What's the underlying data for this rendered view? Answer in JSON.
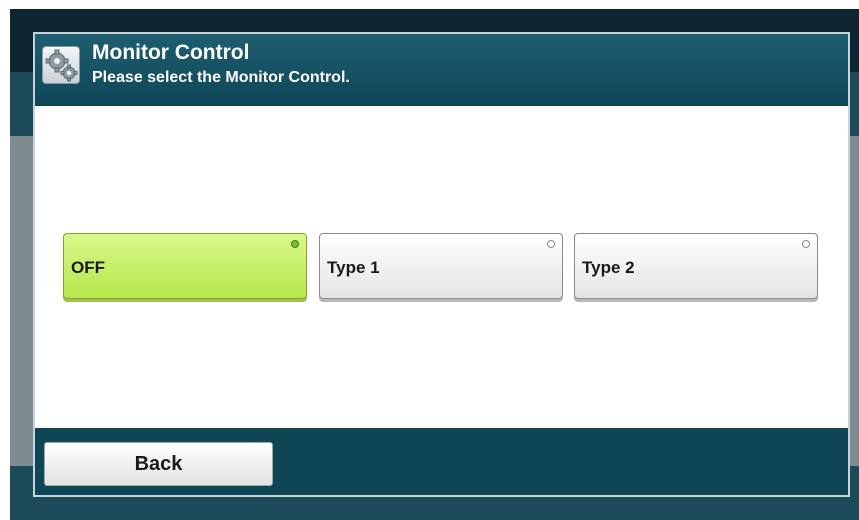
{
  "header": {
    "title": "Monitor Control",
    "subtitle": "Please select the Monitor Control.",
    "icon": "gears-icon"
  },
  "options": [
    {
      "label": "OFF",
      "selected": true
    },
    {
      "label": "Type 1",
      "selected": false
    },
    {
      "label": "Type 2",
      "selected": false
    }
  ],
  "footer": {
    "back_label": "Back"
  },
  "colors": {
    "selected_option": "#c6f06a",
    "header_background": "#0f4655",
    "indicator_on": "#73c12a"
  }
}
